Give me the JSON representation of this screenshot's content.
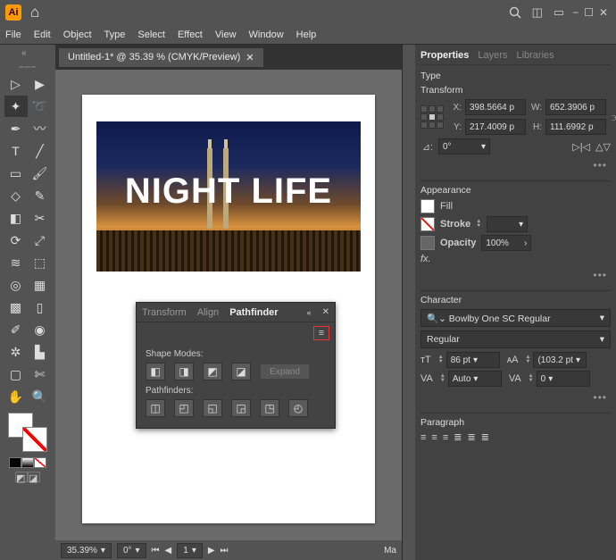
{
  "title_bar": {
    "app_abbr": "Ai",
    "home_icon": "⌂",
    "search_icon": "search",
    "layout1": "◫",
    "layout2": "▭",
    "win_min": "−",
    "win_max": "☐",
    "win_close": "✕"
  },
  "menu": [
    "File",
    "Edit",
    "Object",
    "Type",
    "Select",
    "Effect",
    "View",
    "Window",
    "Help"
  ],
  "document": {
    "tab_label": "Untitled-1* @ 35.39 % (CMYK/Preview)",
    "close": "✕",
    "big_text": "NIGHT LIFE"
  },
  "pathfinder": {
    "tabs": [
      "Transform",
      "Align",
      "Pathfinder"
    ],
    "active_tab": "Pathfinder",
    "collapse": "«",
    "close": "✕",
    "menu_icon": "≡",
    "shape_modes_label": "Shape Modes:",
    "pathfinders_label": "Pathfinders:",
    "expand_label": "Expand",
    "shape_icons": [
      "◧",
      "◨",
      "◩",
      "◪"
    ],
    "path_icons": [
      "◫",
      "◰",
      "◱",
      "◲",
      "◳",
      "◴"
    ]
  },
  "statusbar": {
    "zoom": "35.39%",
    "rotate": "0°",
    "artboard": "1",
    "extra": "Ma"
  },
  "properties": {
    "tabs": [
      "Properties",
      "Layers",
      "Libraries"
    ],
    "active": "Properties",
    "type_label": "Type",
    "transform": {
      "title": "Transform",
      "x_label": "X:",
      "x": "398.5664 p",
      "y_label": "Y:",
      "y": "217.4009 p",
      "w_label": "W:",
      "w": "652.3906 p",
      "h_label": "H:",
      "h": "111.6992 p",
      "rotate_label": "⊿:",
      "rotate": "0°",
      "flip_h": "⟲|⟳",
      "flip_v": "⤧"
    },
    "appearance": {
      "title": "Appearance",
      "fill_label": "Fill",
      "stroke_label": "Stroke",
      "opacity_label": "Opacity",
      "opacity_val": "100%",
      "fx_label": "fx."
    },
    "character": {
      "title": "Character",
      "font_family": "Bowlby One SC Regular",
      "font_style": "Regular",
      "size_prefix": "ᴛT",
      "size": "86 pt",
      "leading_prefix": "ᴀA",
      "leading": "(103.2 pt",
      "tracking_prefix": "VA",
      "tracking": "Auto",
      "kerning_prefix": "VA",
      "kerning": "0"
    },
    "paragraph": {
      "title": "Paragraph"
    },
    "more": "•••"
  },
  "tools": [
    "sel-arrow",
    "direct-sel",
    "magic-wand",
    "lasso",
    "pen",
    "curvature",
    "type",
    "line",
    "rect",
    "brush",
    "shaper",
    "pencil",
    "eraser",
    "rotate",
    "scale",
    "width",
    "free-tf",
    "shape-builder",
    "perspective",
    "mesh",
    "gradient",
    "eyedropper",
    "blend",
    "symbol",
    "graph",
    "artboard",
    "slice",
    "hand",
    "zoom"
  ]
}
